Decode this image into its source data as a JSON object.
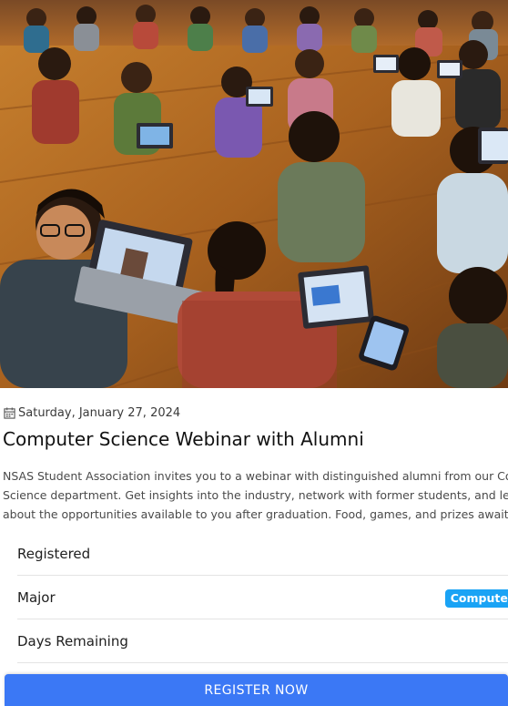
{
  "event": {
    "date": "Saturday, January 27, 2024",
    "title": "Computer Science Webinar with Alumni",
    "description": "NSAS Student Association invites you to a webinar with distinguished alumni from our Computer Science department. Get insights into the industry, network with former students, and learn about the opportunities available to you after graduation. Food, games, and prizes await!"
  },
  "info": {
    "registered_label": "Registered",
    "major_label": "Major",
    "major_value": "Computer",
    "days_label": "Days Remaining"
  },
  "cta": {
    "register_label": "REGISTER NOW"
  },
  "icons": {
    "date": "calendar-icon"
  },
  "colors": {
    "primary": "#3b78f5",
    "chip": "#1aa3f5"
  }
}
